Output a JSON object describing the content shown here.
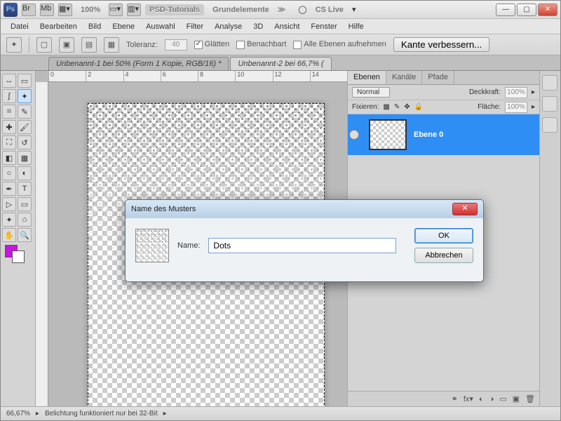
{
  "titlebar": {
    "zoom": "100%",
    "title1": "PSD-Tutorials",
    "title2": "Grundelemente",
    "cs_live": "CS Live"
  },
  "menu": [
    "Datei",
    "Bearbeiten",
    "Bild",
    "Ebene",
    "Auswahl",
    "Filter",
    "Analyse",
    "3D",
    "Ansicht",
    "Fenster",
    "Hilfe"
  ],
  "options": {
    "tolerance_label": "Toleranz:",
    "tolerance_value": "40",
    "smooth": "Glätten",
    "adjacent": "Benachbart",
    "all_layers": "Alle Ebenen aufnehmen",
    "refine_edge": "Kante verbessern..."
  },
  "tabs": [
    "Unbenannt-1 bei 50% (Form 1 Kopie, RGB/16) *",
    "Unbenannt-2 bei 66,7% ("
  ],
  "ruler_marks": [
    "0",
    "2",
    "4",
    "6",
    "8",
    "10",
    "12",
    "14"
  ],
  "panels": {
    "tabs": [
      "Ebenen",
      "Kanäle",
      "Pfade"
    ],
    "mode": "Normal",
    "opacity_label": "Deckkraft:",
    "opacity_val": "100%",
    "lock_label": "Fixieren:",
    "fill_label": "Fläche:",
    "fill_val": "100%",
    "layer_name": "Ebene 0"
  },
  "status": {
    "zoom": "66,67%",
    "msg": "Belichtung funktioniert nur bei 32-Bit"
  },
  "dialog": {
    "title": "Name des Musters",
    "name_label": "Name:",
    "name_value": "Dots",
    "ok": "OK",
    "cancel": "Abbrechen"
  }
}
